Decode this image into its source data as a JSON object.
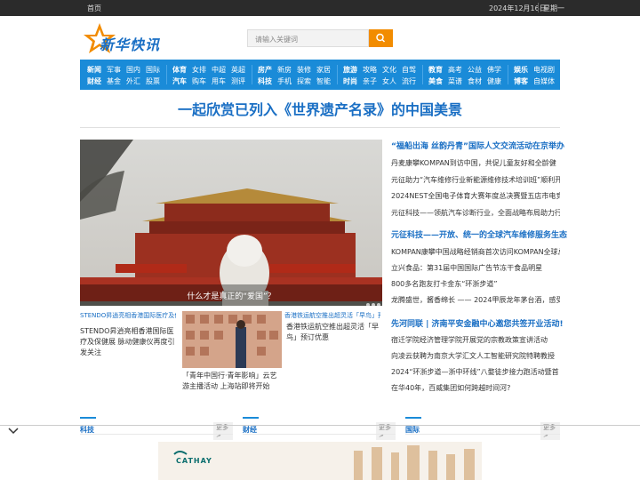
{
  "topbar": {
    "home": "首页",
    "date": "2024年12月16日",
    "weekday": "星期一"
  },
  "logo": {
    "text": "新华快讯"
  },
  "search": {
    "placeholder": "请输入关键词"
  },
  "nav": {
    "groups": [
      {
        "row1": [
          "新闻",
          "军事",
          "国内",
          "国际"
        ],
        "row2": [
          "财经",
          "基金",
          "外汇",
          "股票"
        ]
      },
      {
        "row1": [
          "体育",
          "女排",
          "中超",
          "英超"
        ],
        "row2": [
          "汽车",
          "购车",
          "用车",
          "测评"
        ]
      },
      {
        "row1": [
          "房产",
          "新房",
          "装修",
          "家居"
        ],
        "row2": [
          "科技",
          "手机",
          "探索",
          "智能"
        ]
      },
      {
        "row1": [
          "旅游",
          "攻略",
          "文化",
          "自驾"
        ],
        "row2": [
          "时尚",
          "亲子",
          "女人",
          "流行"
        ]
      },
      {
        "row1": [
          "教育",
          "高考",
          "公益",
          "佛学"
        ],
        "row2": [
          "美食",
          "菜谱",
          "食材",
          "健康"
        ]
      },
      {
        "row1": [
          "娱乐",
          "电视剧"
        ],
        "row2": [
          "博客",
          "自媒体"
        ]
      }
    ]
  },
  "headline": "一起欣赏已列入《世界遗产名录》的中国美景",
  "slider": {
    "caption": "什么才是真正的“爱国”？"
  },
  "thumbs": [
    {
      "alt": "STENDO昇逍亮相香港国际医疗及保健展 脉动健康仪再度引发关注",
      "text": "STENDO昇逍亮相香港国际医疗及保健展 脉动健康仪再度引发关注"
    },
    {
      "alt": "",
      "text": "「青年中国行·青年影响」云艺游主播活动 上海站即将开始"
    },
    {
      "alt": "香港铁运航空推出超灵活「早鸟」预订优惠",
      "text": "香港铁运航空推出超灵活「早鸟」预订优惠"
    }
  ],
  "right": {
    "block1": {
      "title": "“福船出海 丝韵丹青”国际人文交流活动在京举办",
      "items": [
        "丹麦康攀KOMPAN到访中国，共促儿童友好和全龄健",
        "元征助力“汽车维修行业新能源维修技术培训班”顺利开班",
        "2024NEST全国电子体育大赛年度总决赛暨五店市电竞节",
        "元征科技——领航汽车诊断行业，全面战略布局助力行业"
      ]
    },
    "block2": {
      "title": "元征科技——开放、统一的全球汽车维修服务生态",
      "items": [
        "KOMPAN康攀中国战略经销商首次访问KOMPAN全球总",
        "立兴食品：第31届中国国际广告节冻干食品明星",
        "800多名跑友打卡金东“环浙步道”",
        "龙腾盛世，酱香绵长 —— 2024甲辰龙年茅台酒，感受传"
      ]
    },
    "block3": {
      "title": "先河同联 | 济南平安金融中心邀您共签开业活动!",
      "items": [
        "宿迁学院经济管理学院开展党的宗教政策宣讲活动",
        "向凌云获聘为南京大学汇文人工智能研究院特聘教授",
        "2024“环浙步道—浙中环线”八婺徒步接力跑活动暨首",
        "在华40年，百威集团如何跨越时间河?"
      ]
    }
  },
  "sections": [
    {
      "title": "科技",
      "more": "更多>"
    },
    {
      "title": "财经",
      "more": "更多>"
    },
    {
      "title": "国际",
      "more": "更多>"
    }
  ],
  "ad": {
    "brand": "CATHAY"
  },
  "colors": {
    "accent": "#1a8bd8",
    "brand": "#1a6fc4",
    "search_btn": "#f28c00",
    "topbar": "#2b2b2b"
  }
}
